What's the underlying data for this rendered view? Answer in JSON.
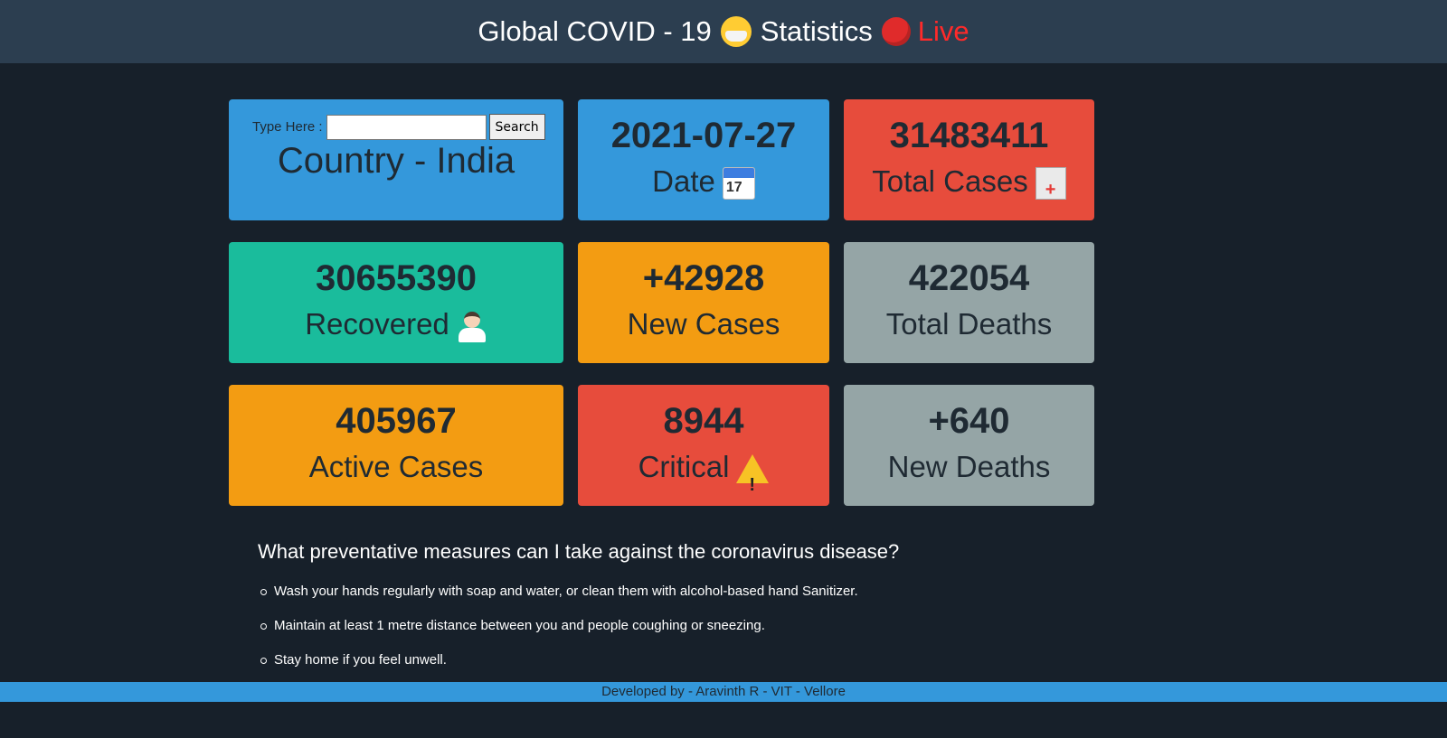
{
  "header": {
    "title": "Global COVID - 19",
    "title_suffix": "Statistics",
    "live_label": "Live",
    "mask_icon": "face-with-medical-mask-icon",
    "dot_icon": "red-circle-icon"
  },
  "search": {
    "label": "Type Here :",
    "value": "",
    "placeholder": "",
    "button_label": "Search"
  },
  "country": {
    "title": "Country - India"
  },
  "cards": {
    "date": {
      "value": "2021-07-27",
      "label": "Date",
      "icon": "calendar-icon",
      "color": "#3498db"
    },
    "total_cases": {
      "value": "31483411",
      "label": "Total Cases",
      "icon": "hospital-icon",
      "color": "#e74c3c"
    },
    "recovered": {
      "value": "30655390",
      "label": "Recovered",
      "icon": "doctor-icon",
      "color": "#1abc9c"
    },
    "new_cases": {
      "value": "+42928",
      "label": "New Cases",
      "color": "#f39c12"
    },
    "total_deaths": {
      "value": "422054",
      "label": "Total Deaths",
      "color": "#95a5a6"
    },
    "active_cases": {
      "value": "405967",
      "label": "Active Cases",
      "color": "#f39c12"
    },
    "critical": {
      "value": "8944",
      "label": "Critical",
      "icon": "warning-icon",
      "color": "#e74c3c"
    },
    "new_deaths": {
      "value": "+640",
      "label": "New Deaths",
      "color": "#95a5a6"
    }
  },
  "calendar_icon_day": "17",
  "faq": {
    "question": "What preventative measures can I take against the coronavirus disease?",
    "items": [
      "Wash your hands regularly with soap and water, or clean them with alcohol-based hand Sanitizer.",
      "Maintain at least 1 metre distance between you and people coughing or sneezing.",
      "Stay home if you feel unwell."
    ]
  },
  "footer": {
    "text": "Developed by - Aravinth R - VIT - Vellore"
  },
  "colors": {
    "background": "#17202a",
    "header_bg": "#2c3e50",
    "live": "#ff2a2a",
    "footer_bg": "#3498db"
  }
}
